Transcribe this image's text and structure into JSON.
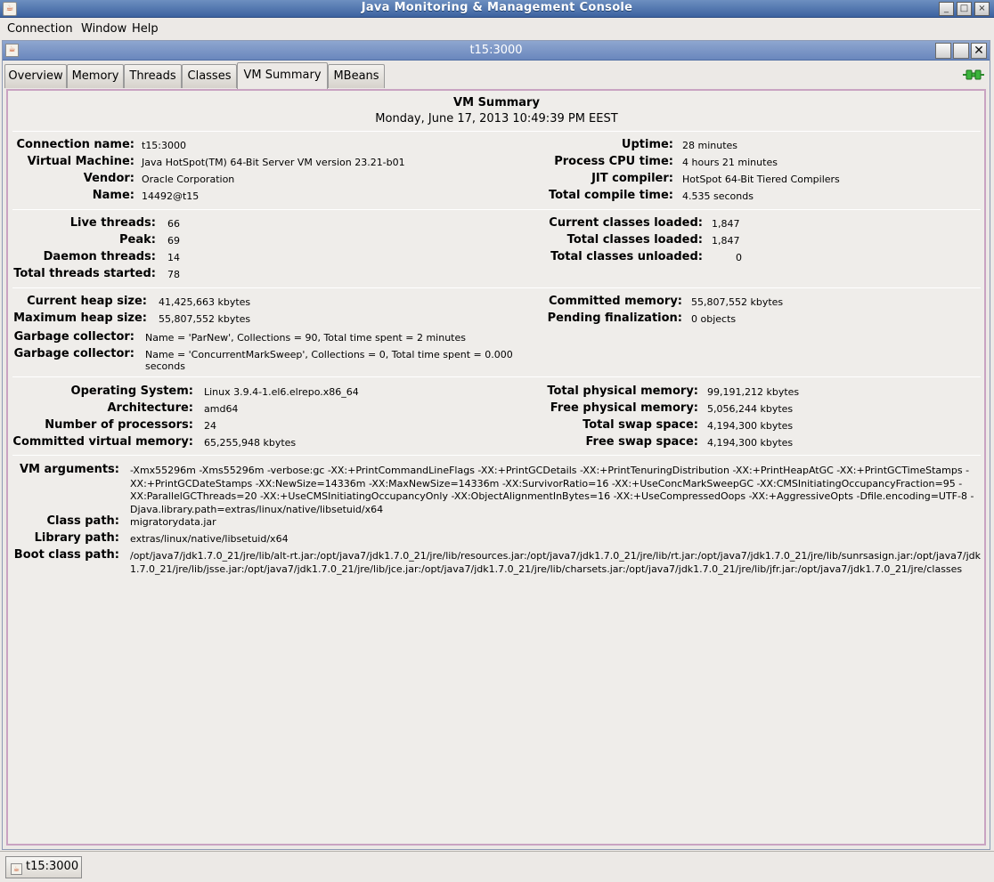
{
  "window": {
    "title": "Java Monitoring & Management Console"
  },
  "menu": [
    "Connection",
    "Window",
    "Help"
  ],
  "frame": {
    "title": "t15:3000"
  },
  "tabs": [
    "Overview",
    "Memory",
    "Threads",
    "Classes",
    "VM Summary",
    "MBeans"
  ],
  "active_tab": "VM Summary",
  "summary": {
    "title": "VM Summary",
    "date": "Monday, June 17, 2013 10:49:39 PM EEST"
  },
  "s1": {
    "connection_name": {
      "label": "Connection name:",
      "value": "t15:3000"
    },
    "virtual_machine": {
      "label": "Virtual Machine:",
      "value": "Java HotSpot(TM) 64-Bit Server VM version 23.21-b01"
    },
    "vendor": {
      "label": "Vendor:",
      "value": "Oracle Corporation"
    },
    "name": {
      "label": "Name:",
      "value": "14492@t15"
    },
    "uptime": {
      "label": "Uptime:",
      "value": "28 minutes"
    },
    "process_cpu_time": {
      "label": "Process CPU time:",
      "value": "4 hours 21 minutes"
    },
    "jit_compiler": {
      "label": "JIT compiler:",
      "value": "HotSpot 64-Bit Tiered Compilers"
    },
    "total_compile_time": {
      "label": "Total compile time:",
      "value": "4.535 seconds"
    }
  },
  "s2": {
    "live_threads": {
      "label": "Live threads:",
      "value": "66"
    },
    "peak": {
      "label": "Peak:",
      "value": "69"
    },
    "daemon_threads": {
      "label": "Daemon threads:",
      "value": "14"
    },
    "total_threads_started": {
      "label": "Total threads started:",
      "value": "78"
    },
    "current_classes_loaded": {
      "label": "Current classes loaded:",
      "value": "1,847"
    },
    "total_classes_loaded": {
      "label": "Total classes loaded:",
      "value": "1,847"
    },
    "total_classes_unloaded": {
      "label": "Total classes unloaded:",
      "value": "0"
    }
  },
  "s3": {
    "current_heap_size": {
      "label": "Current heap size:",
      "value": "41,425,663 kbytes"
    },
    "maximum_heap_size": {
      "label": "Maximum heap size:",
      "value": "55,807,552 kbytes"
    },
    "gc1": {
      "label": "Garbage collector:",
      "value": "Name = 'ParNew', Collections = 90, Total time spent = 2 minutes"
    },
    "gc2": {
      "label": "Garbage collector:",
      "value": "Name = 'ConcurrentMarkSweep', Collections = 0, Total time spent = 0.000 seconds"
    },
    "committed_memory": {
      "label": "Committed memory:",
      "value": "55,807,552 kbytes"
    },
    "pending_finalization": {
      "label": "Pending finalization:",
      "value": "0 objects"
    }
  },
  "s4": {
    "operating_system": {
      "label": "Operating System:",
      "value": "Linux 3.9.4-1.el6.elrepo.x86_64"
    },
    "architecture": {
      "label": "Architecture:",
      "value": "amd64"
    },
    "number_of_processors": {
      "label": "Number of processors:",
      "value": "24"
    },
    "committed_virtual_memory": {
      "label": "Committed virtual memory:",
      "value": "65,255,948 kbytes"
    },
    "total_physical_memory": {
      "label": "Total physical memory:",
      "value": "99,191,212 kbytes"
    },
    "free_physical_memory": {
      "label": "Free physical memory:",
      "value": "5,056,244 kbytes"
    },
    "total_swap_space": {
      "label": "Total swap space:",
      "value": "4,194,300 kbytes"
    },
    "free_swap_space": {
      "label": "Free swap space:",
      "value": "4,194,300 kbytes"
    }
  },
  "s5": {
    "vm_arguments": {
      "label": "VM arguments:",
      "value": "-Xmx55296m -Xms55296m -verbose:gc -XX:+PrintCommandLineFlags -XX:+PrintGCDetails -XX:+PrintTenuringDistribution -XX:+PrintHeapAtGC -XX:+PrintGCTimeStamps -XX:+PrintGCDateStamps -XX:NewSize=14336m -XX:MaxNewSize=14336m -XX:SurvivorRatio=16 -XX:+UseConcMarkSweepGC -XX:CMSInitiatingOccupancyFraction=95 -XX:ParallelGCThreads=20 -XX:+UseCMSInitiatingOccupancyOnly -XX:ObjectAlignmentInBytes=16 -XX:+UseCompressedOops -XX:+AggressiveOpts -Dfile.encoding=UTF-8 -Djava.library.path=extras/linux/native/libsetuid/x64"
    },
    "class_path": {
      "label": "Class path:",
      "value": "migratorydata.jar"
    },
    "library_path": {
      "label": "Library path:",
      "value": "extras/linux/native/libsetuid/x64"
    },
    "boot_class_path": {
      "label": "Boot class path:",
      "value": "/opt/java7/jdk1.7.0_21/jre/lib/alt-rt.jar:/opt/java7/jdk1.7.0_21/jre/lib/resources.jar:/opt/java7/jdk1.7.0_21/jre/lib/rt.jar:/opt/java7/jdk1.7.0_21/jre/lib/sunrsasign.jar:/opt/java7/jdk1.7.0_21/jre/lib/jsse.jar:/opt/java7/jdk1.7.0_21/jre/lib/jce.jar:/opt/java7/jdk1.7.0_21/jre/lib/charsets.jar:/opt/java7/jdk1.7.0_21/jre/lib/jfr.jar:/opt/java7/jdk1.7.0_21/jre/classes"
    }
  },
  "taskbar": {
    "item": "t15:3000"
  }
}
